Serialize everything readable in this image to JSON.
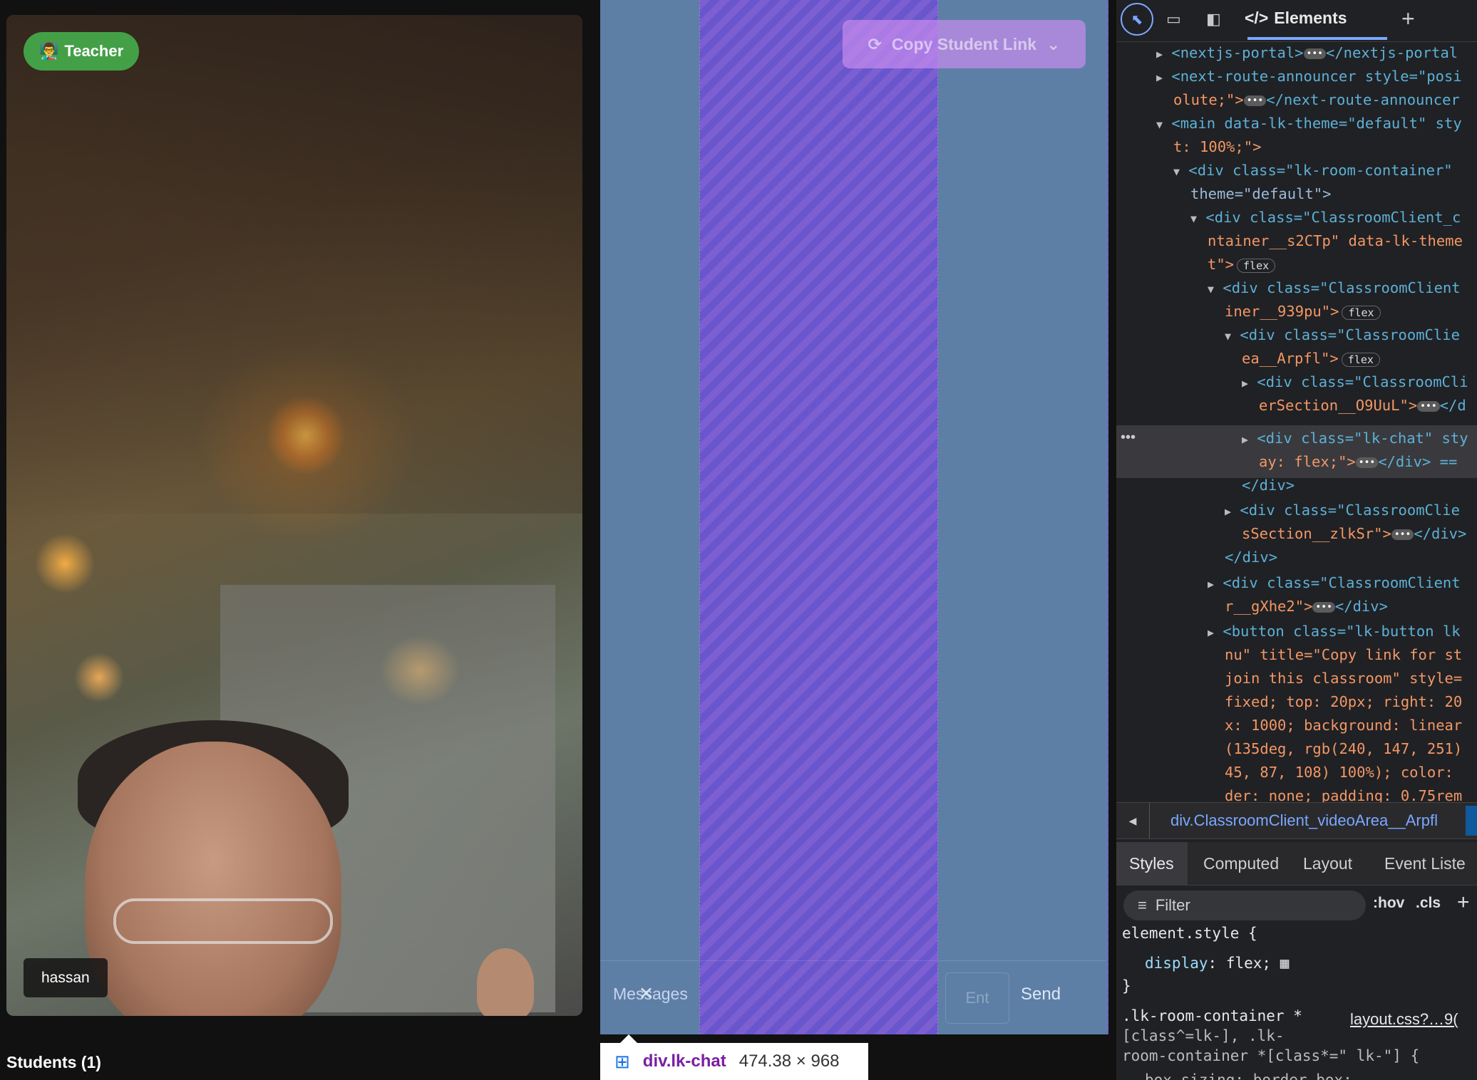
{
  "video": {
    "teacher_badge": "Teacher",
    "teacher_icon": "👨‍🏫",
    "participant_name": "hassan"
  },
  "chat": {
    "copy_button": "Copy Student Link",
    "messages_label": "Messages",
    "close_glyph": "✕",
    "input_placeholder": "Ent",
    "send_label": "Send"
  },
  "inspect_tooltip": {
    "element": "div.lk-chat",
    "dimensions": "474.38 × 968"
  },
  "students_heading": "Students (1)",
  "devtools": {
    "elements_tab": "Elements",
    "dom_lines": [
      "<nextjs-portal>",
      "</nextjs-portal",
      "<next-route-announcer style=\"posi",
      "olute;\">",
      "</next-route-announcer",
      "<main data-lk-theme=\"default\" sty",
      "t: 100%;\">",
      "<div class=\"lk-room-container\"",
      "theme=\"default\">",
      "<div class=\"ClassroomClient_c",
      "ntainer__s2CTp\" data-lk-theme",
      "t\">",
      "<div class=\"ClassroomClient",
      "iner__939pu\">",
      "<div class=\"ClassroomClie",
      "ea__Arpfl\">",
      "<div class=\"ClassroomCli",
      "erSection__O9UuL\">",
      "</d",
      "<div class=\"lk-chat\" sty",
      "ay: flex;\">",
      "</div> ==",
      "</div>",
      "<div class=\"ClassroomClie",
      "sSection__zlkSr\">",
      "</div>",
      "</div>",
      "<div class=\"ClassroomClient",
      "r__gXhe2\">",
      "</div>",
      "<button class=\"lk-button lk",
      "nu\" title=\"Copy link for st",
      "join this classroom\" style=",
      "fixed; top: 20px; right: 20",
      "x: 1000; background: linear",
      "(135deg, rgb(240, 147, 251)",
      "45, 87, 108) 100%); color:",
      "der: none; padding: 0.75rem"
    ],
    "flex_badge": "flex",
    "breadcrumb": "div.ClassroomClient_videoArea__Arpfl",
    "styles_tabs": [
      "Styles",
      "Computed",
      "Layout",
      "Event Liste"
    ],
    "filter_placeholder": "Filter",
    "hov": ":hov",
    "cls": ".cls",
    "css_rules": {
      "element_style": "element.style {",
      "display_prop": "display",
      "display_val": "flex;",
      "close_brace": "}",
      "rule2_selector_a": ".lk-room-container *",
      "rule2_file": "layout.css?…9(",
      "rule2_selector_b": "[class^=lk-], .lk-",
      "rule2_selector_c": "room-container *[class*=\" lk-\"] {",
      "box_sizing": "box-sizing: border-box;"
    }
  },
  "colors": {
    "teacher_badge": "#43a047",
    "chat_panel": "#5d7fa6",
    "chat_highlight": "#8a50e6",
    "copy_button": "#c88cf0",
    "devtools_bg": "#202124",
    "devtools_accent": "#7aa7ff"
  }
}
